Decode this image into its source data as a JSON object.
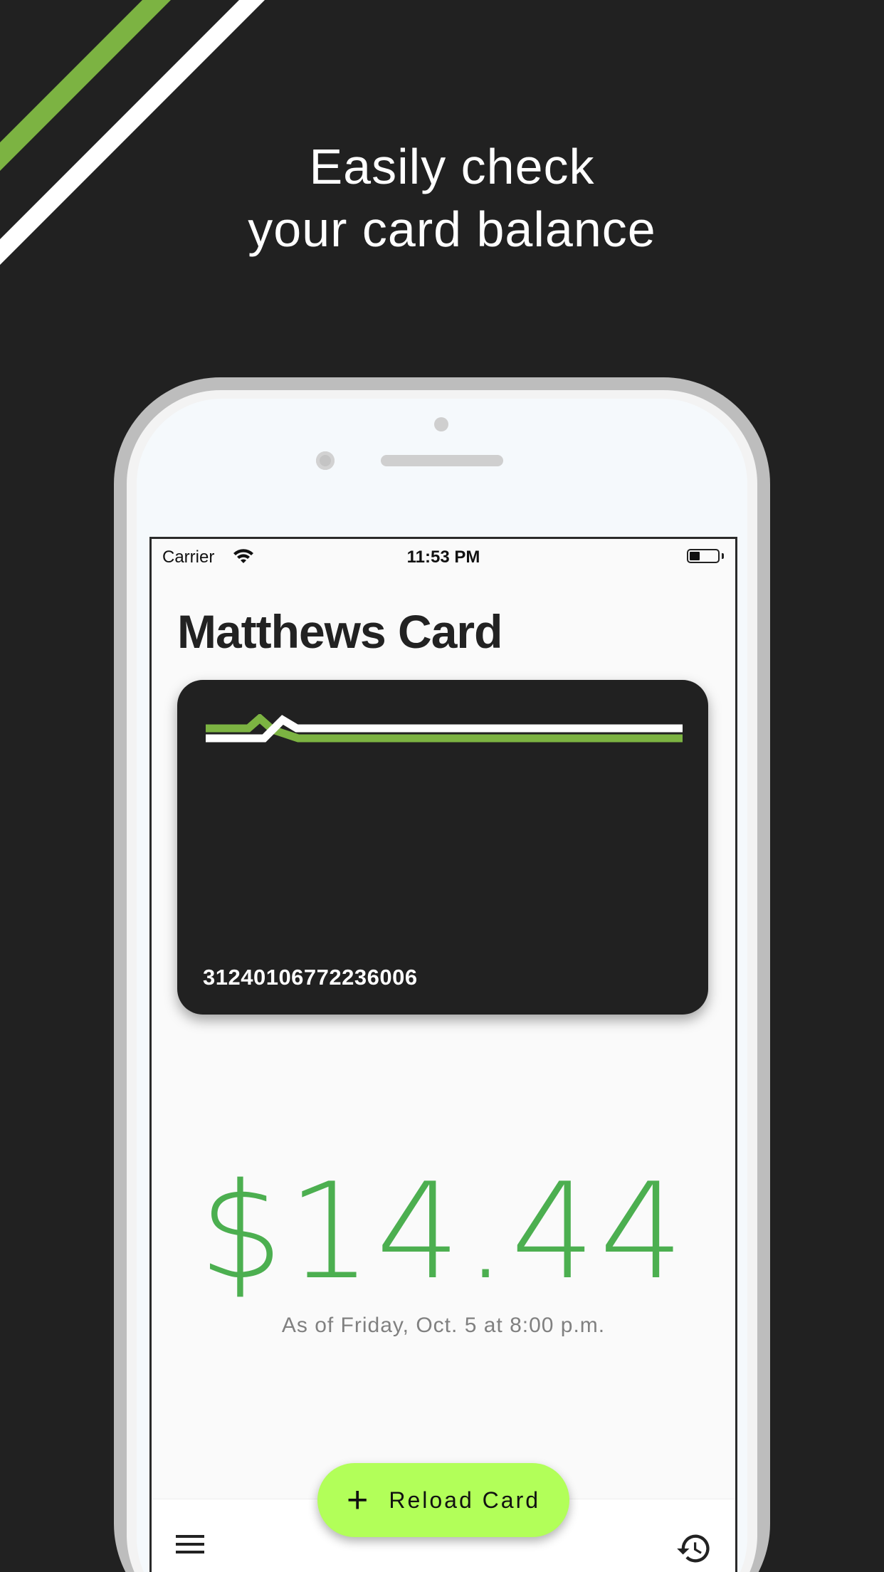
{
  "promo": {
    "headline_line1": "Easily check",
    "headline_line2": "your card balance"
  },
  "status_bar": {
    "carrier": "Carrier",
    "time": "11:53 PM"
  },
  "app": {
    "title": "Matthews Card"
  },
  "card": {
    "number": "31240106772236006"
  },
  "balance": {
    "amount": "$14.44",
    "as_of": "As of Friday, Oct. 5 at 8:00 p.m."
  },
  "actions": {
    "reload_label": "Reload Card",
    "reload_icon": "plus-icon",
    "menu_icon": "menu-icon",
    "history_icon": "history-icon"
  },
  "colors": {
    "background": "#212121",
    "accent_green": "#7cb342",
    "balance_green": "#4caf50",
    "fab": "#b2ff59"
  }
}
